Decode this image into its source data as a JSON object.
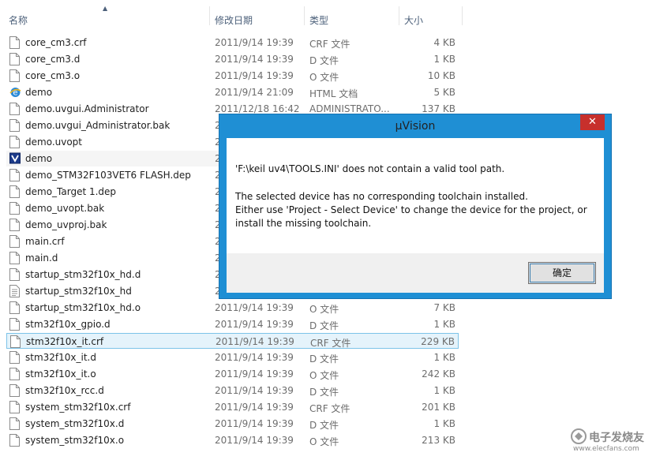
{
  "columns": {
    "name": "名称",
    "modified": "修改日期",
    "type": "类型",
    "size": "大小"
  },
  "files": [
    {
      "name": "core_cm3.crf",
      "date": "2011/9/14 19:39",
      "type": "CRF 文件",
      "size": "4 KB",
      "icon": "file-icon"
    },
    {
      "name": "core_cm3.d",
      "date": "2011/9/14 19:39",
      "type": "D 文件",
      "size": "1 KB",
      "icon": "file-icon"
    },
    {
      "name": "core_cm3.o",
      "date": "2011/9/14 19:39",
      "type": "O 文件",
      "size": "10 KB",
      "icon": "file-icon"
    },
    {
      "name": "demo",
      "date": "2011/9/14 21:09",
      "type": "HTML 文档",
      "size": "5 KB",
      "icon": "ie-html-icon"
    },
    {
      "name": "demo.uvgui.Administrator",
      "date": "2011/12/18 16:42",
      "type": "ADMINISTRATO...",
      "size": "137 KB",
      "icon": "file-icon"
    },
    {
      "name": "demo.uvgui_Administrator.bak",
      "date": "2",
      "type": "",
      "size": "",
      "icon": "file-icon"
    },
    {
      "name": "demo.uvopt",
      "date": "2",
      "type": "",
      "size": "",
      "icon": "file-icon"
    },
    {
      "name": "demo",
      "date": "2",
      "type": "",
      "size": "",
      "icon": "uvision-project-icon"
    },
    {
      "name": "demo_STM32F103VET6 FLASH.dep",
      "date": "2",
      "type": "",
      "size": "",
      "icon": "file-icon"
    },
    {
      "name": "demo_Target 1.dep",
      "date": "2",
      "type": "",
      "size": "",
      "icon": "file-icon"
    },
    {
      "name": "demo_uvopt.bak",
      "date": "2",
      "type": "",
      "size": "",
      "icon": "file-icon"
    },
    {
      "name": "demo_uvproj.bak",
      "date": "2",
      "type": "",
      "size": "",
      "icon": "file-icon"
    },
    {
      "name": "main.crf",
      "date": "2",
      "type": "",
      "size": "",
      "icon": "file-icon"
    },
    {
      "name": "main.d",
      "date": "2",
      "type": "",
      "size": "",
      "icon": "file-icon"
    },
    {
      "name": "startup_stm32f10x_hd.d",
      "date": "2",
      "type": "",
      "size": "",
      "icon": "file-icon"
    },
    {
      "name": "startup_stm32f10x_hd",
      "date": "2",
      "type": "",
      "size": "",
      "icon": "text-file-icon"
    },
    {
      "name": "startup_stm32f10x_hd.o",
      "date": "2011/9/14 19:39",
      "type": "O 文件",
      "size": "7 KB",
      "icon": "file-icon"
    },
    {
      "name": "stm32f10x_gpio.d",
      "date": "2011/9/14 19:39",
      "type": "D 文件",
      "size": "1 KB",
      "icon": "file-icon"
    },
    {
      "name": "stm32f10x_it.crf",
      "date": "2011/9/14 19:39",
      "type": "CRF 文件",
      "size": "229 KB",
      "icon": "file-icon"
    },
    {
      "name": "stm32f10x_it.d",
      "date": "2011/9/14 19:39",
      "type": "D 文件",
      "size": "1 KB",
      "icon": "file-icon"
    },
    {
      "name": "stm32f10x_it.o",
      "date": "2011/9/14 19:39",
      "type": "O 文件",
      "size": "242 KB",
      "icon": "file-icon"
    },
    {
      "name": "stm32f10x_rcc.d",
      "date": "2011/9/14 19:39",
      "type": "D 文件",
      "size": "1 KB",
      "icon": "file-icon"
    },
    {
      "name": "system_stm32f10x.crf",
      "date": "2011/9/14 19:39",
      "type": "CRF 文件",
      "size": "201 KB",
      "icon": "file-icon"
    },
    {
      "name": "system_stm32f10x.d",
      "date": "2011/9/14 19:39",
      "type": "D 文件",
      "size": "1 KB",
      "icon": "file-icon"
    },
    {
      "name": "system_stm32f10x.o",
      "date": "2011/9/14 19:39",
      "type": "O 文件",
      "size": "213 KB",
      "icon": "file-icon"
    }
  ],
  "selected_file": "stm32f10x_it.crf",
  "hovered_file": "demo",
  "dialog": {
    "title": "µVision",
    "close": "✕",
    "message1": "'F:\\keil uv4\\TOOLS.INI' does not contain a valid tool path.",
    "message2_line1": "The selected device has no corresponding toolchain installed.",
    "message2_line2": "Either use 'Project - Select Device' to change the device for the project, or",
    "message2_line3": "install the missing toolchain.",
    "ok_label": "确定"
  },
  "watermark": {
    "text": "电子发烧友",
    "url": "www.elecfans.com"
  },
  "colors": {
    "dialog_frame": "#1f8fd4",
    "close_button": "#c7302c",
    "selection": "#e5f3fb"
  }
}
